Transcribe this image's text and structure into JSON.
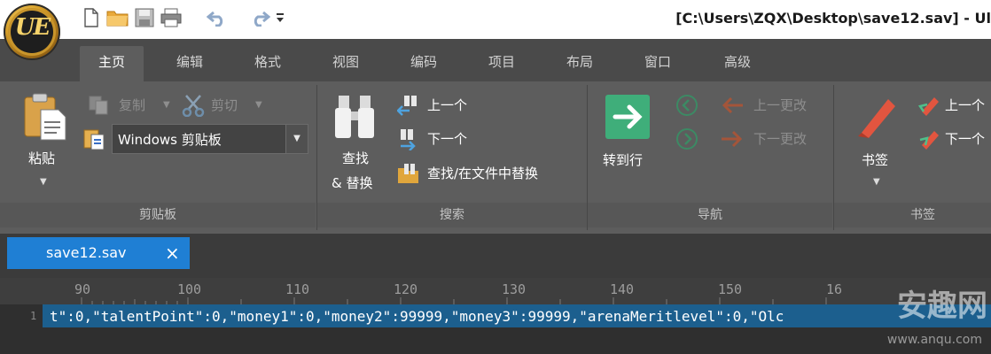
{
  "window": {
    "title": "[C:\\Users\\ZQX\\Desktop\\save12.sav] - Ul",
    "logo_text": "UE"
  },
  "qat": {
    "icons": [
      "new-file-icon",
      "open-folder-icon",
      "save-icon",
      "print-icon",
      "undo-icon",
      "redo-icon",
      "qat-dropdown-icon"
    ]
  },
  "tabs": [
    "主页",
    "编辑",
    "格式",
    "视图",
    "编码",
    "项目",
    "布局",
    "窗口",
    "高级"
  ],
  "ribbon": {
    "clipboard": {
      "paste": "粘贴",
      "copy": "复制",
      "cut": "剪切",
      "dropdown_value": "Windows 剪贴板",
      "group": "剪贴板"
    },
    "search": {
      "find_replace_line1": "查找",
      "find_replace_line2": "& 替换",
      "prev": "上一个",
      "next": "下一个",
      "find_in_files": "查找/在文件中替换",
      "group": "搜索"
    },
    "navigation": {
      "goto": "转到行",
      "prev_change": "上一更改",
      "next_change": "下一更改",
      "group": "导航"
    },
    "bookmarks": {
      "bookmark": "书签",
      "prev": "上一个",
      "next": "下一个",
      "group": "书签"
    }
  },
  "document": {
    "tab_name": "save12.sav",
    "ruler": [
      "90",
      "100",
      "110",
      "120",
      "130",
      "140",
      "150",
      "16"
    ],
    "line_number": "1",
    "line_text": "t\":0,\"talentPoint\":0,\"money1\":0,\"money2\":99999,\"money3\":99999,\"arenaMeritlevel\":0,\"Olc"
  },
  "watermark": {
    "text": "安趣网",
    "url": "www.anqu.com"
  },
  "colors": {
    "tab_bar": "#4a4a4a",
    "ribbon": "#5d5d5d",
    "doc_tab": "#1f7fd4",
    "selection": "#1c5f8e"
  }
}
